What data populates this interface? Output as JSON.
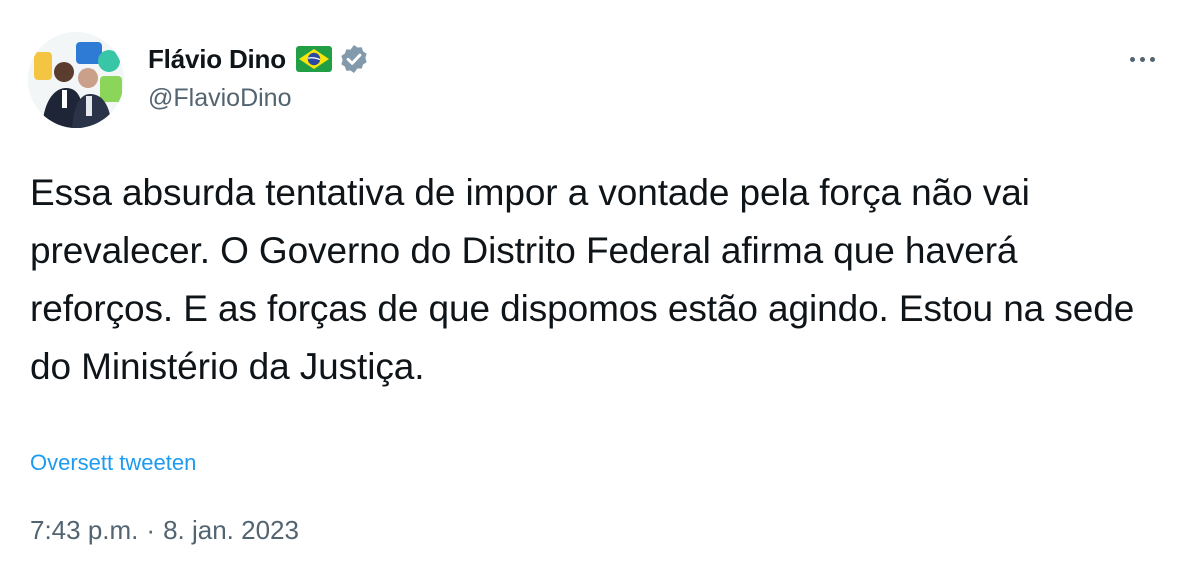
{
  "author": {
    "name": "Flávio Dino",
    "handle": "@FlavioDino",
    "flag_icon": "brazil-flag-icon",
    "verified_icon": "verified-badge-icon",
    "verified_color": "#829aab"
  },
  "menu": {
    "icon": "more-options-icon"
  },
  "tweet": {
    "text": "Essa absurda tentativa de impor a vontade pela força não vai prevalecer. O Governo do Distrito Federal afirma que haverá reforços. E as forças de que dispomos estão agindo. Estou na sede do Ministério da Justiça.",
    "translate_label": "Oversett tweeten",
    "time": "7:43 p.m.",
    "separator": "·",
    "date": "8. jan. 2023"
  },
  "colors": {
    "link": "#1d9bf0",
    "secondary_text": "#536471",
    "primary_text": "#0f1419"
  }
}
